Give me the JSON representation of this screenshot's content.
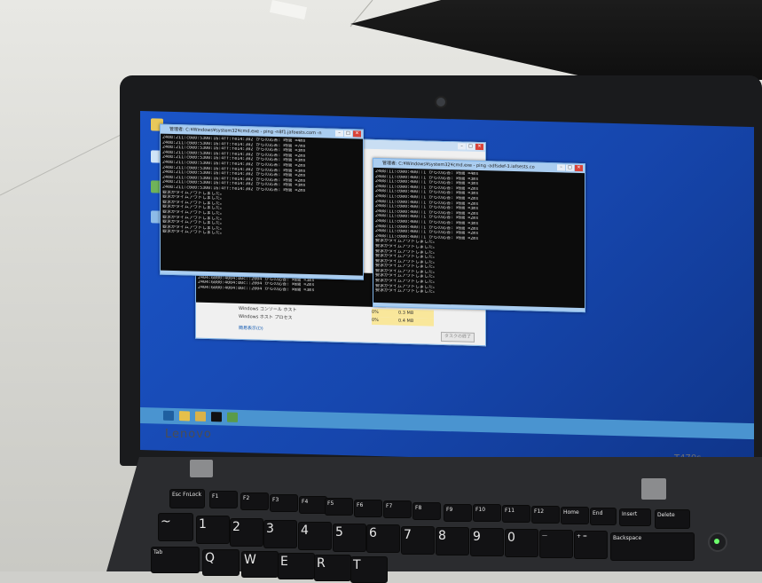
{
  "scene": {
    "laptop_brand": "Lenovo",
    "laptop_model": "T470s"
  },
  "windows": [
    {
      "title": "管理者: C:¥Windows¥system32¥cmd.exe - ping -n8f1.jafoests.com -n",
      "lines": [
        "2408:211:c0e0:5300:16:4ff:fe14:302 からの応答: 時間 =4ms",
        "2408:211:c0e0:5300:16:4ff:fe14:302 からの応答: 時間 =7ms",
        "2408:211:c0e0:5300:16:4ff:fe14:302 からの応答: 時間 =3ms",
        "2408:211:c0e0:5300:16:4ff:fe14:302 からの応答: 時間 =2ms",
        "2408:211:c0e0:5300:16:4ff:fe14:302 からの応答: 時間 =3ms",
        "2408:211:c0e0:5300:16:4ff:fe14:302 からの応答: 時間 =2ms",
        "2408:211:c0e0:5300:16:4ff:fe14:302 からの応答: 時間 =3ms",
        "2408:211:c0e0:5300:16:4ff:fe14:302 からの応答: 時間 =2ms",
        "2408:211:c0e0:5300:16:4ff:fe14:302 からの応答: 時間 =2ms",
        "2408:211:c0e0:5300:16:4ff:fe14:302 からの応答: 時間 =3ms",
        "2408:211:c0e0:5300:16:4ff:fe14:302 からの応答: 時間 =2ms",
        "要求がタイムアウトしました。",
        "要求がタイムアウトしました。",
        "要求がタイムアウトしました。",
        "要求がタイムアウトしました。",
        "要求がタイムアウトしました。",
        "要求がタイムアウトしました。",
        "要求がタイムアウトしました。",
        "要求がタイムアウトしました。",
        "要求がタイムアウトしました。"
      ]
    },
    {
      "title": "管理者: C:¥Windows¥system32¥cmd.exe - ping -adfsdef-3.iafsests.co",
      "lines": [
        "2408:11:c0e0:400::1 からの応答: 時間 =4ms",
        "2408:11:c0e0:400::1 からの応答: 時間 =3ms",
        "2408:11:c0e0:400::1 からの応答: 時間 =3ms",
        "2408:11:c0e0:400::1 からの応答: 時間 =2ms",
        "2408:11:c0e0:400::1 からの応答: 時間 =3ms",
        "2408:11:c0e0:400::1 からの応答: 時間 =2ms",
        "2408:11:c0e0:400::1 からの応答: 時間 =2ms",
        "2408:11:c0e0:400::1 からの応答: 時間 =3ms",
        "2408:11:c0e0:400::1 からの応答: 時間 =2ms",
        "2408:11:c0e0:400::1 からの応答: 時間 =2ms",
        "2408:11:c0e0:400::1 からの応答: 時間 =3ms",
        "2408:11:c0e0:400::1 からの応答: 時間 =2ms",
        "2408:11:c0e0:400::1 からの応答: 時間 =2ms",
        "2408:11:c0e0:400::1 からの応答: 時間 =2ms",
        "要求がタイムアウトしました。",
        "要求がタイムアウトしました。",
        "要求がタイムアウトしました。",
        "要求がタイムアウトしました。",
        "要求がタイムアウトしました。",
        "要求がタイムアウトしました。",
        "要求がタイムアウトしました。",
        "要求がタイムアウトしました。",
        "要求がタイムアウトしました。",
        "要求がタイムアウトしました。",
        "要求がタイムアウトしました。"
      ]
    },
    {
      "lines": [
        "2404:6800:4004:80c::2004 からの応答: 時間 =5ms",
        "2404:6800:4004:80c::2004 からの応答: 時間 =3ms",
        "2404:6800:4004:80c::2004 からの応答: 時間 =2ms",
        "2404:6800:4004:80c::2004 からの応答: 時間 =3ms"
      ]
    }
  ],
  "task_manager": {
    "rows": [
      {
        "name": "Windows コンソール ホスト",
        "col2": "",
        "col3": "0%",
        "col4": "0.3 MB"
      },
      {
        "name": "Windows ホスト プロセス",
        "col2": "",
        "col3": "0%",
        "col4": "0.4 MB"
      }
    ],
    "footer": "簡易表示(D)",
    "button": "タスクの終了"
  },
  "keyboard": {
    "keys": [
      {
        "id": "esc",
        "label": "Esc FnLock"
      },
      {
        "id": "f1",
        "label": "F1"
      },
      {
        "id": "f2",
        "label": "F2"
      },
      {
        "id": "f3",
        "label": "F3"
      },
      {
        "id": "f4",
        "label": "F4"
      },
      {
        "id": "f5",
        "label": "F5"
      },
      {
        "id": "f6",
        "label": "F6"
      },
      {
        "id": "f7",
        "label": "F7"
      },
      {
        "id": "f8",
        "label": "F8"
      },
      {
        "id": "f9",
        "label": "F9"
      },
      {
        "id": "f10",
        "label": "F10"
      },
      {
        "id": "f11",
        "label": "F11"
      },
      {
        "id": "f12",
        "label": "F12"
      },
      {
        "id": "home",
        "label": "Home"
      },
      {
        "id": "end",
        "label": "End"
      },
      {
        "id": "insert",
        "label": "Insert"
      },
      {
        "id": "delete",
        "label": "Delete"
      },
      {
        "id": "tilde",
        "label": "~"
      },
      {
        "id": "1",
        "label": "1"
      },
      {
        "id": "2",
        "label": "2"
      },
      {
        "id": "3",
        "label": "3"
      },
      {
        "id": "4",
        "label": "4"
      },
      {
        "id": "5",
        "label": "5"
      },
      {
        "id": "6",
        "label": "6"
      },
      {
        "id": "7",
        "label": "7"
      },
      {
        "id": "8",
        "label": "8"
      },
      {
        "id": "9",
        "label": "9"
      },
      {
        "id": "0",
        "label": "0"
      },
      {
        "id": "minus",
        "label": "—"
      },
      {
        "id": "plus",
        "label": "+ ="
      },
      {
        "id": "backspace",
        "label": "Backspace"
      },
      {
        "id": "tab",
        "label": "Tab"
      },
      {
        "id": "q",
        "label": "Q"
      },
      {
        "id": "w",
        "label": "W"
      },
      {
        "id": "e",
        "label": "E"
      },
      {
        "id": "r",
        "label": "R"
      },
      {
        "id": "t",
        "label": "T"
      }
    ]
  }
}
